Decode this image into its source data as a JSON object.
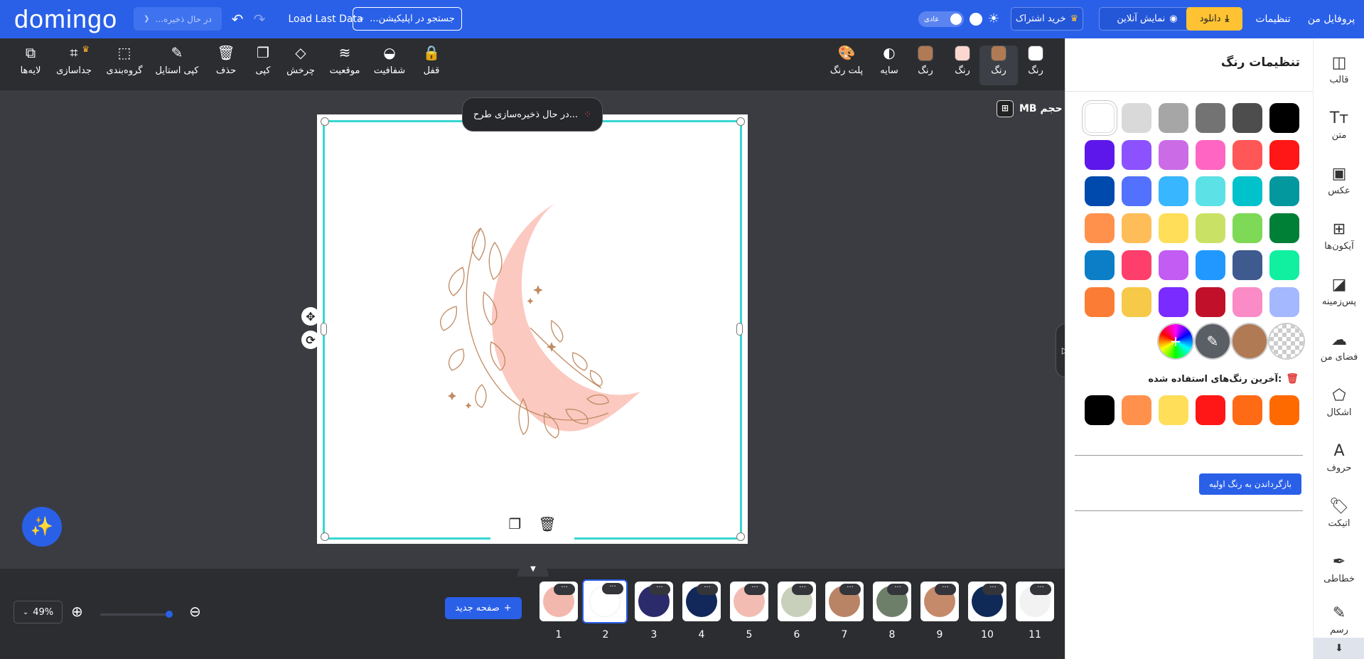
{
  "header": {
    "logo": "domingo",
    "saving_pill": "در حال ذخیره...",
    "load_last": "Load Last Data",
    "search_placeholder": "جستجو در اپلیکیشن...",
    "mode_toggle": "عادی",
    "buy_subscription": "خرید اشتراک",
    "online_preview": "نمایش آنلاین",
    "download": "دانلود",
    "settings": "تنظیمات",
    "profile": "پروفایل من"
  },
  "toolbar": {
    "left_tools": [
      {
        "label": "لایه‌ها",
        "icon": "layers-icon"
      },
      {
        "label": "جداسازی",
        "icon": "separate-icon"
      },
      {
        "label": "گروه‌بندی",
        "icon": "group-icon"
      },
      {
        "label": "کپی استایل",
        "icon": "brush-icon"
      },
      {
        "label": "حذف",
        "icon": "trash-icon"
      },
      {
        "label": "کپی",
        "icon": "copy-icon"
      },
      {
        "label": "چرخش",
        "icon": "rotate-icon"
      },
      {
        "label": "موقعیت",
        "icon": "position-icon"
      },
      {
        "label": "شفافیت",
        "icon": "opacity-icon"
      },
      {
        "label": "قفل",
        "icon": "lock-icon"
      }
    ],
    "right_tools": [
      {
        "label": "پلت رنگ",
        "icon": "palette-icon"
      },
      {
        "label": "سایه",
        "icon": "shadow-icon"
      },
      {
        "label": "رنگ",
        "color": "#b07a55"
      },
      {
        "label": "رنگ",
        "color": "#fcd7d0"
      },
      {
        "label": "رنگ",
        "color": "#b07a55"
      },
      {
        "label": "رنگ",
        "color": "#ffffff"
      }
    ]
  },
  "canvas": {
    "saving_toast": "در حال ذخیره‌سازی طرح...",
    "size_label": "حجم MB"
  },
  "bottom": {
    "zoom": "49%",
    "new_page": "صفحه جدید",
    "pages": [
      {
        "num": "1",
        "color": "#f3b8ad"
      },
      {
        "num": "2",
        "color": "#ffffff"
      },
      {
        "num": "3",
        "color": "#2b2a6b"
      },
      {
        "num": "4",
        "color": "#12285a"
      },
      {
        "num": "5",
        "color": "#f3bcb2"
      },
      {
        "num": "6",
        "color": "#c8cfbb"
      },
      {
        "num": "7",
        "color": "#b98466"
      },
      {
        "num": "8",
        "color": "#6d7f69"
      },
      {
        "num": "9",
        "color": "#c58a6a"
      },
      {
        "num": "10",
        "color": "#0f2a56"
      },
      {
        "num": "11",
        "color": "#f2f2f2"
      }
    ]
  },
  "color_panel": {
    "title": "تنظیمات رنگ",
    "rows": [
      [
        "#000000",
        "#4d4d4d",
        "#737373",
        "#a6a6a6",
        "#d9d9d9",
        "#ffffff"
      ],
      [
        "#ff1616",
        "#ff5757",
        "#ff66c4",
        "#cb6ce6",
        "#8c52ff",
        "#5e17eb"
      ],
      [
        "#03989e",
        "#00c2cb",
        "#5ce1e6",
        "#38b6ff",
        "#5271ff",
        "#004aad"
      ],
      [
        "#008037",
        "#7ed957",
        "#c9e265",
        "#ffde59",
        "#ffbd59",
        "#ff914d"
      ],
      [
        "#10f0a0",
        "#3e5a8f",
        "#2098ff",
        "#c35cf2",
        "#ff3f6b",
        "#0b7ec7"
      ],
      [
        "#a3b8ff",
        "#fa8bc6",
        "#c0102a",
        "#7a2bff",
        "#f7c948",
        "#fb7d35"
      ]
    ],
    "row7": [
      "transparent",
      "#b07a55",
      "eyedropper",
      "add-color"
    ],
    "recent_title": "آخرین رنگ‌های استفاده شده:",
    "recent": [
      "#ff6a00",
      "#ff6a15",
      "#ff1616",
      "#ffde59",
      "#ff914d",
      "#000000"
    ],
    "reset": "بازگرداندن به رنگ اولیه"
  },
  "nav": [
    {
      "label": "قالب",
      "icon": "template-icon"
    },
    {
      "label": "متن",
      "icon": "text-icon"
    },
    {
      "label": "عکس",
      "icon": "photo-icon"
    },
    {
      "label": "آیکون‌ها",
      "icon": "icons-grid-icon"
    },
    {
      "label": "پس‌زمینه",
      "icon": "background-icon"
    },
    {
      "label": "فضای من",
      "icon": "cloud-upload-icon"
    },
    {
      "label": "اشکال",
      "icon": "shapes-icon"
    },
    {
      "label": "حروف",
      "icon": "letters-icon"
    },
    {
      "label": "اتیکت",
      "icon": "tag-icon"
    },
    {
      "label": "خطاطی",
      "icon": "feather-icon"
    },
    {
      "label": "رسم",
      "icon": "pencil-icon"
    }
  ]
}
